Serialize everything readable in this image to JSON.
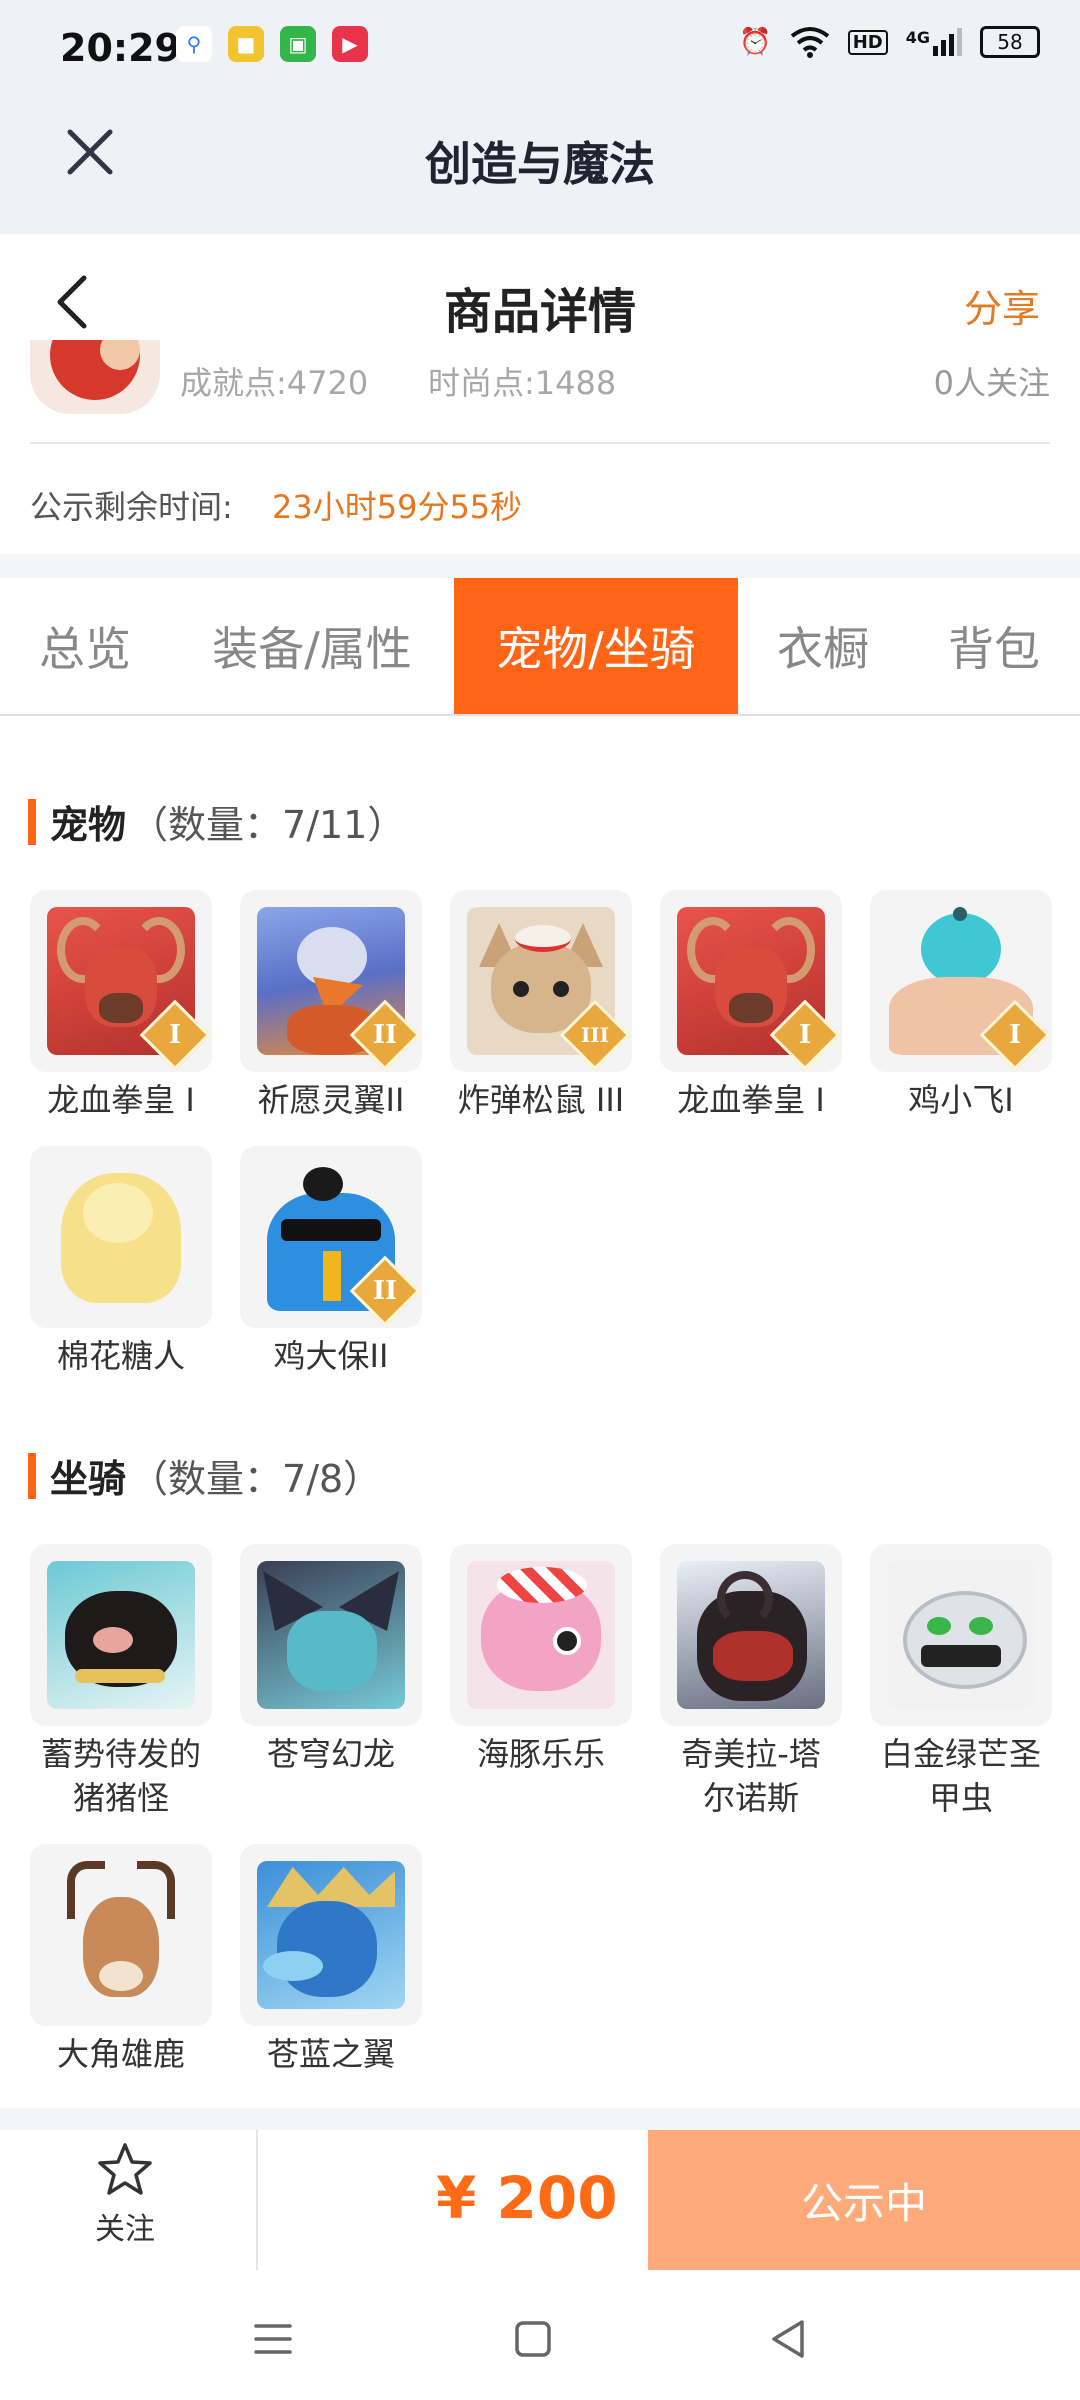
{
  "status_bar": {
    "time": "20:29",
    "battery": "58",
    "network": "4G",
    "hd": "HD"
  },
  "app": {
    "title": "创造与魔法"
  },
  "header": {
    "title": "商品详情",
    "share_label": "分享"
  },
  "info": {
    "achievement": "成就点:4720",
    "fashion": "时尚点:1488",
    "followers": "0人关注",
    "remaining_label": "公示剩余时间:",
    "remaining_value": "23小时59分55秒"
  },
  "tabs": [
    {
      "label": "总览"
    },
    {
      "label": "装备/属性"
    },
    {
      "label": "宠物/坐骑",
      "active": true
    },
    {
      "label": "衣橱"
    },
    {
      "label": "背包"
    }
  ],
  "pets": {
    "title": "宠物",
    "count": "（数量：7/11）",
    "items": [
      {
        "name": "龙血拳皇 I",
        "badge": "I"
      },
      {
        "name": "祈愿灵翼II",
        "badge": "II"
      },
      {
        "name": "炸弹松鼠 III",
        "badge": "III"
      },
      {
        "name": "龙血拳皇 I",
        "badge": "I"
      },
      {
        "name": "鸡小飞I",
        "badge": "I"
      },
      {
        "name": "棉花糖人",
        "badge": ""
      },
      {
        "name": "鸡大保II",
        "badge": "II"
      }
    ]
  },
  "mounts": {
    "title": "坐骑",
    "count": "（数量：7/8）",
    "items": [
      {
        "name": "蓄势待发的\n猪猪怪"
      },
      {
        "name": "苍穹幻龙"
      },
      {
        "name": "海豚乐乐"
      },
      {
        "name": "奇美拉-塔\n尔诺斯"
      },
      {
        "name": "白金绿芒圣\n甲虫"
      },
      {
        "name": "大角雄鹿"
      },
      {
        "name": "苍蓝之翼"
      }
    ]
  },
  "bottom": {
    "follow_label": "关注",
    "price": "¥ 200",
    "status_label": "公示中"
  },
  "colors": {
    "accent": "#ff6417",
    "accent_text": "#e8761e",
    "status_button": "#ffaa7a"
  }
}
